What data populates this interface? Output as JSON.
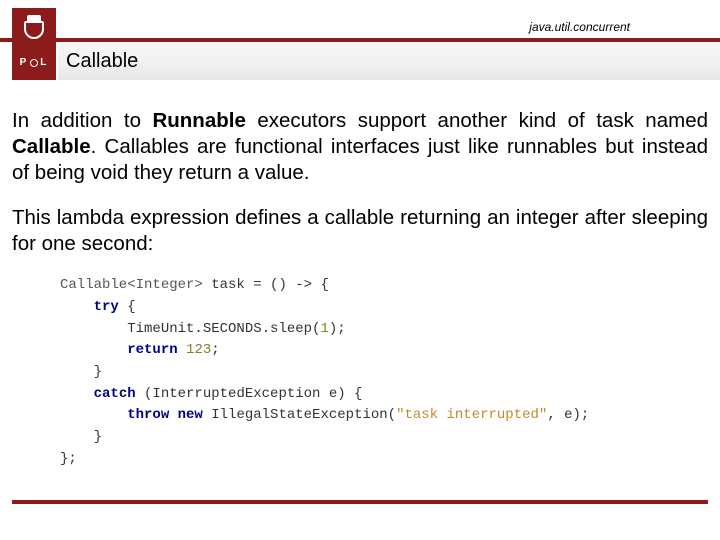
{
  "header": {
    "package": "java.util.concurrent",
    "title": "Callable",
    "logo_letters_left": "P",
    "logo_letters_right": "L"
  },
  "paragraphs": {
    "p1_a": "In addition to ",
    "p1_bold1": "Runnable",
    "p1_b": " executors support another kind of task named ",
    "p1_bold2": "Callable",
    "p1_c": ". Callables are functional interfaces just like runnables but instead of being void they return a value.",
    "p2": "This lambda expression defines a callable returning an integer after sleeping for one second:"
  },
  "code": {
    "l1_a": "Callable<Integer>",
    "l1_b": " task = () -> {",
    "l2_kw": "try",
    "l2_b": " {",
    "l3_a": "TimeUnit.SECONDS.sleep(",
    "l3_num": "1",
    "l3_b": ");",
    "l4_kw": "return",
    "l4_sp": " ",
    "l4_num": "123",
    "l4_b": ";",
    "l5": "}",
    "l6_kw": "catch",
    "l6_b": " (InterruptedException e) {",
    "l7_kw": "throw new",
    "l7_a": " IllegalStateException(",
    "l7_str": "\"task interrupted\"",
    "l7_b": ", e);",
    "l8": "}",
    "l9": "};"
  },
  "colors": {
    "brand": "#8c1c1c"
  }
}
